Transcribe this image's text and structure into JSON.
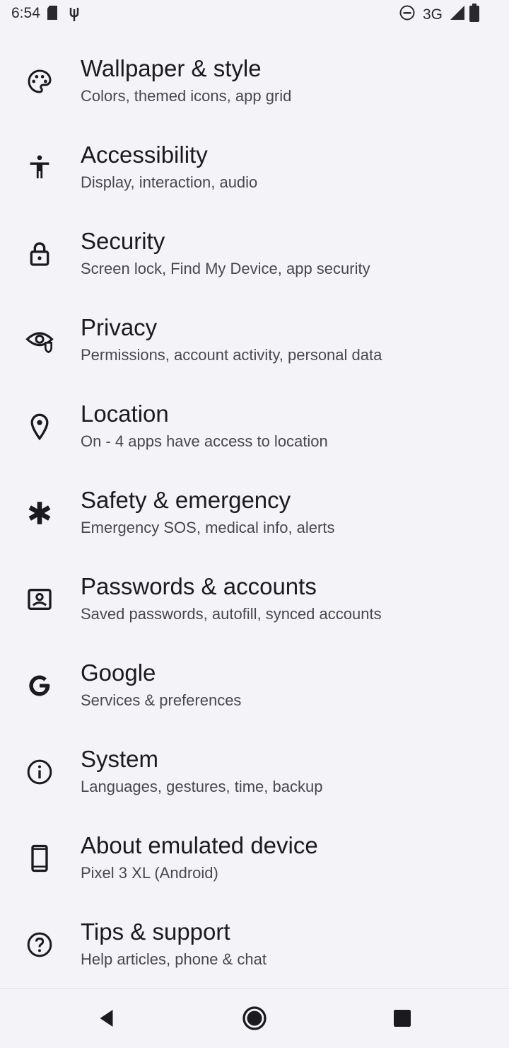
{
  "status_bar": {
    "time": "6:54",
    "network": "3G",
    "icons": [
      "sd-card-icon",
      "usb-icon",
      "do-not-disturb-icon",
      "signal-icon",
      "battery-icon"
    ]
  },
  "settings": {
    "items": [
      {
        "title": "Wallpaper & style",
        "subtitle": "Colors, themed icons, app grid",
        "icon": "palette-icon"
      },
      {
        "title": "Accessibility",
        "subtitle": "Display, interaction, audio",
        "icon": "accessibility-icon"
      },
      {
        "title": "Security",
        "subtitle": "Screen lock, Find My Device, app security",
        "icon": "lock-icon"
      },
      {
        "title": "Privacy",
        "subtitle": "Permissions, account activity, personal data",
        "icon": "privacy-eye-icon"
      },
      {
        "title": "Location",
        "subtitle": "On - 4 apps have access to location",
        "icon": "location-pin-icon"
      },
      {
        "title": "Safety & emergency",
        "subtitle": "Emergency SOS, medical info, alerts",
        "icon": "emergency-asterisk-icon"
      },
      {
        "title": "Passwords & accounts",
        "subtitle": "Saved passwords, autofill, synced accounts",
        "icon": "account-box-icon"
      },
      {
        "title": "Google",
        "subtitle": "Services & preferences",
        "icon": "google-g-icon"
      },
      {
        "title": "System",
        "subtitle": "Languages, gestures, time, backup",
        "icon": "info-circle-icon"
      },
      {
        "title": "About emulated device",
        "subtitle": "Pixel 3 XL (Android)",
        "icon": "phone-icon"
      },
      {
        "title": "Tips & support",
        "subtitle": "Help articles, phone & chat",
        "icon": "help-circle-icon"
      }
    ]
  },
  "nav": {
    "buttons": [
      "back-icon",
      "home-icon",
      "recents-icon"
    ]
  }
}
